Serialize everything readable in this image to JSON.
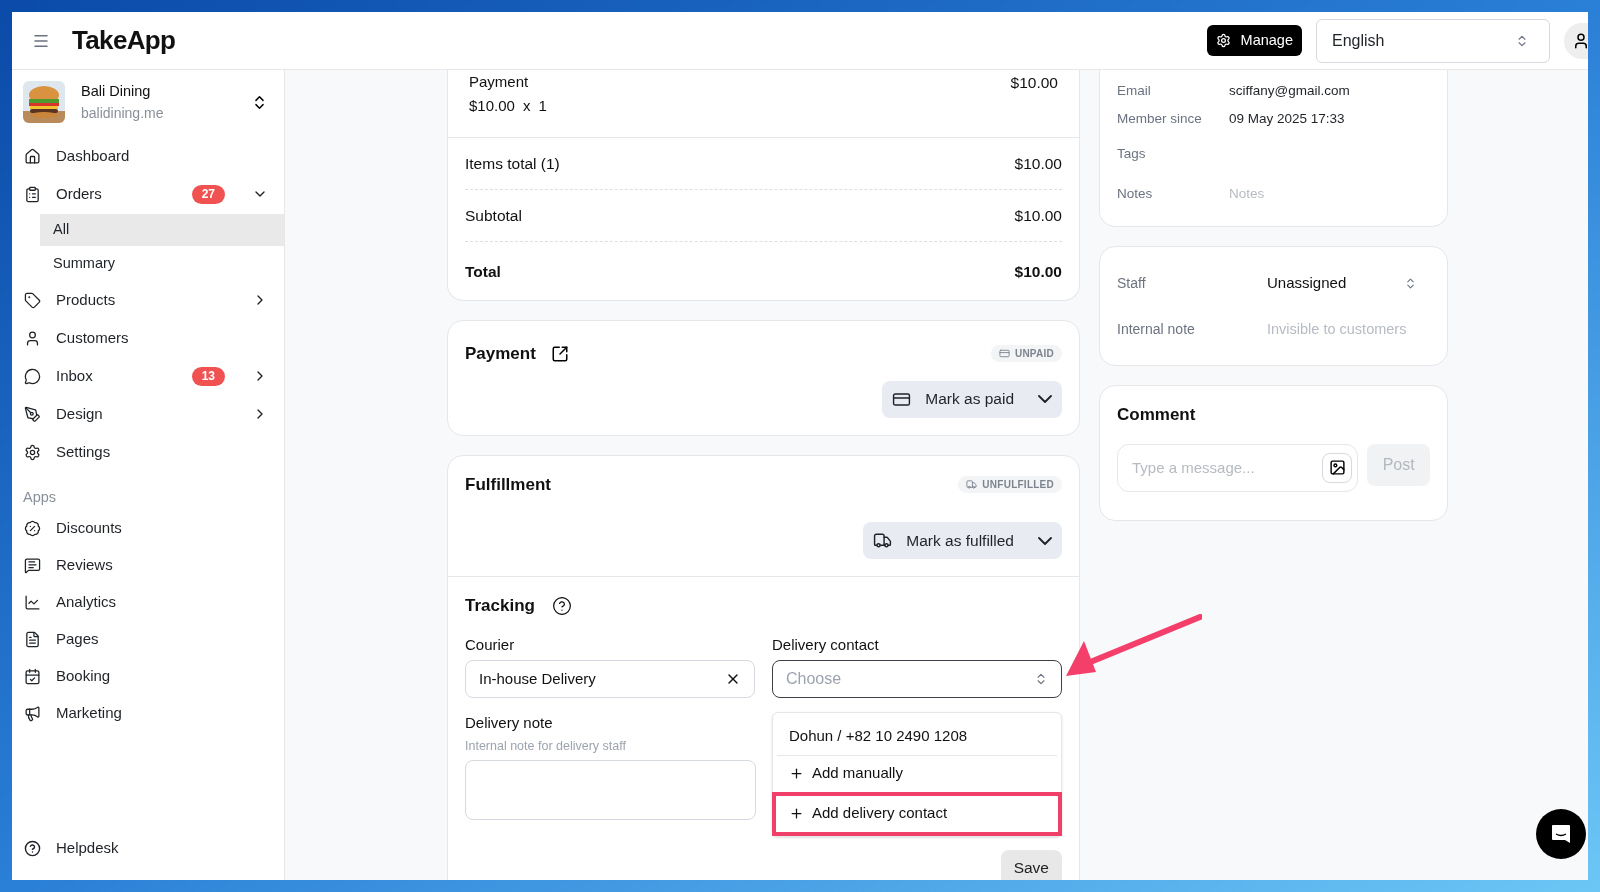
{
  "header": {
    "logo": "TakeApp",
    "manage_button": "Manage",
    "language": "English"
  },
  "sidebar": {
    "store": {
      "name": "Bali Dining",
      "domain": "balidining.me"
    },
    "nav": [
      {
        "label": "Dashboard",
        "selected": false
      },
      {
        "label": "Orders",
        "selected": false,
        "badge": "27",
        "expanded": true,
        "children": [
          {
            "label": "All",
            "selected": true
          },
          {
            "label": "Summary",
            "selected": false
          }
        ]
      },
      {
        "label": "Products",
        "selected": false,
        "expanded": false
      },
      {
        "label": "Customers",
        "selected": false
      },
      {
        "label": "Inbox",
        "selected": false,
        "badge": "13",
        "expanded": false
      },
      {
        "label": "Design",
        "selected": false,
        "expanded": false
      },
      {
        "label": "Settings",
        "selected": false
      }
    ],
    "apps_heading": "Apps",
    "apps": [
      {
        "label": "Discounts",
        "selected": false
      },
      {
        "label": "Reviews",
        "selected": false
      },
      {
        "label": "Analytics",
        "selected": false
      },
      {
        "label": "Pages",
        "selected": false
      },
      {
        "label": "Booking",
        "selected": false
      },
      {
        "label": "Marketing",
        "selected": false
      }
    ],
    "helpdesk": "Helpdesk"
  },
  "order_summary": {
    "line_item": {
      "name": "Payment",
      "unit_price": "$10.00",
      "times": "x",
      "quantity": "1",
      "line_total": "$10.00"
    },
    "totals": [
      {
        "label": "Items total (1)",
        "value": "$10.00",
        "kind": "row"
      },
      {
        "label": "Subtotal",
        "value": "$10.00",
        "kind": "row"
      },
      {
        "label": "Total",
        "value": "$10.00",
        "kind": "grand"
      }
    ]
  },
  "payment": {
    "title": "Payment",
    "status": "UNPAID",
    "action": "Mark as paid"
  },
  "fulfillment": {
    "title": "Fulfillment",
    "status": "UNFULFILLED",
    "action": "Mark as fulfilled"
  },
  "tracking": {
    "title": "Tracking",
    "courier": {
      "label": "Courier",
      "value": "In-house Delivery"
    },
    "delivery_contact": {
      "label": "Delivery contact",
      "placeholder": "Choose",
      "open": true,
      "options": [
        {
          "label": "Dohun / +82 10 2490 1208",
          "kind": "contact",
          "highlighted": false
        },
        {
          "label": "Add manually",
          "kind": "add",
          "highlighted": false
        },
        {
          "label": "Add delivery contact",
          "kind": "add",
          "highlighted": true
        }
      ]
    },
    "delivery_note": {
      "label": "Delivery note",
      "hint": "Internal note for delivery staff"
    },
    "save_button": "Save"
  },
  "customer": {
    "fields": [
      {
        "label": "Email",
        "value": "sciffany@gmail.com"
      },
      {
        "label": "Member since",
        "value": "09 May 2025 17:33"
      },
      {
        "label": "Tags"
      },
      {
        "label": "Notes",
        "placeholder": "Notes"
      }
    ]
  },
  "assignment": {
    "staff": {
      "label": "Staff",
      "value": "Unassigned"
    },
    "internal_note": {
      "label": "Internal note",
      "placeholder": "Invisible to customers"
    }
  },
  "comment": {
    "title": "Comment",
    "placeholder": "Type a message...",
    "post_button": "Post",
    "post_disabled": true
  }
}
